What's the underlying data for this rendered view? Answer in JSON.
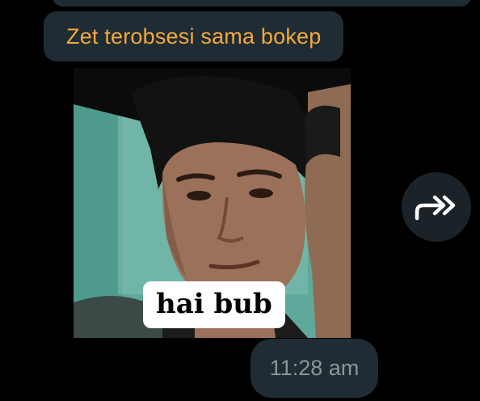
{
  "message": {
    "quoted_text": "Zet terobsesi sama bokep",
    "sticker_caption": "hai bub",
    "timestamp": "11:28 am"
  },
  "icons": {
    "forward": "forward-double-arrow-icon"
  },
  "colors": {
    "background": "#000000",
    "bubble": "#1f2c34",
    "quote_text": "#f5a83a",
    "timestamp_text": "#8d9599",
    "forward_button": "#1b2329"
  }
}
